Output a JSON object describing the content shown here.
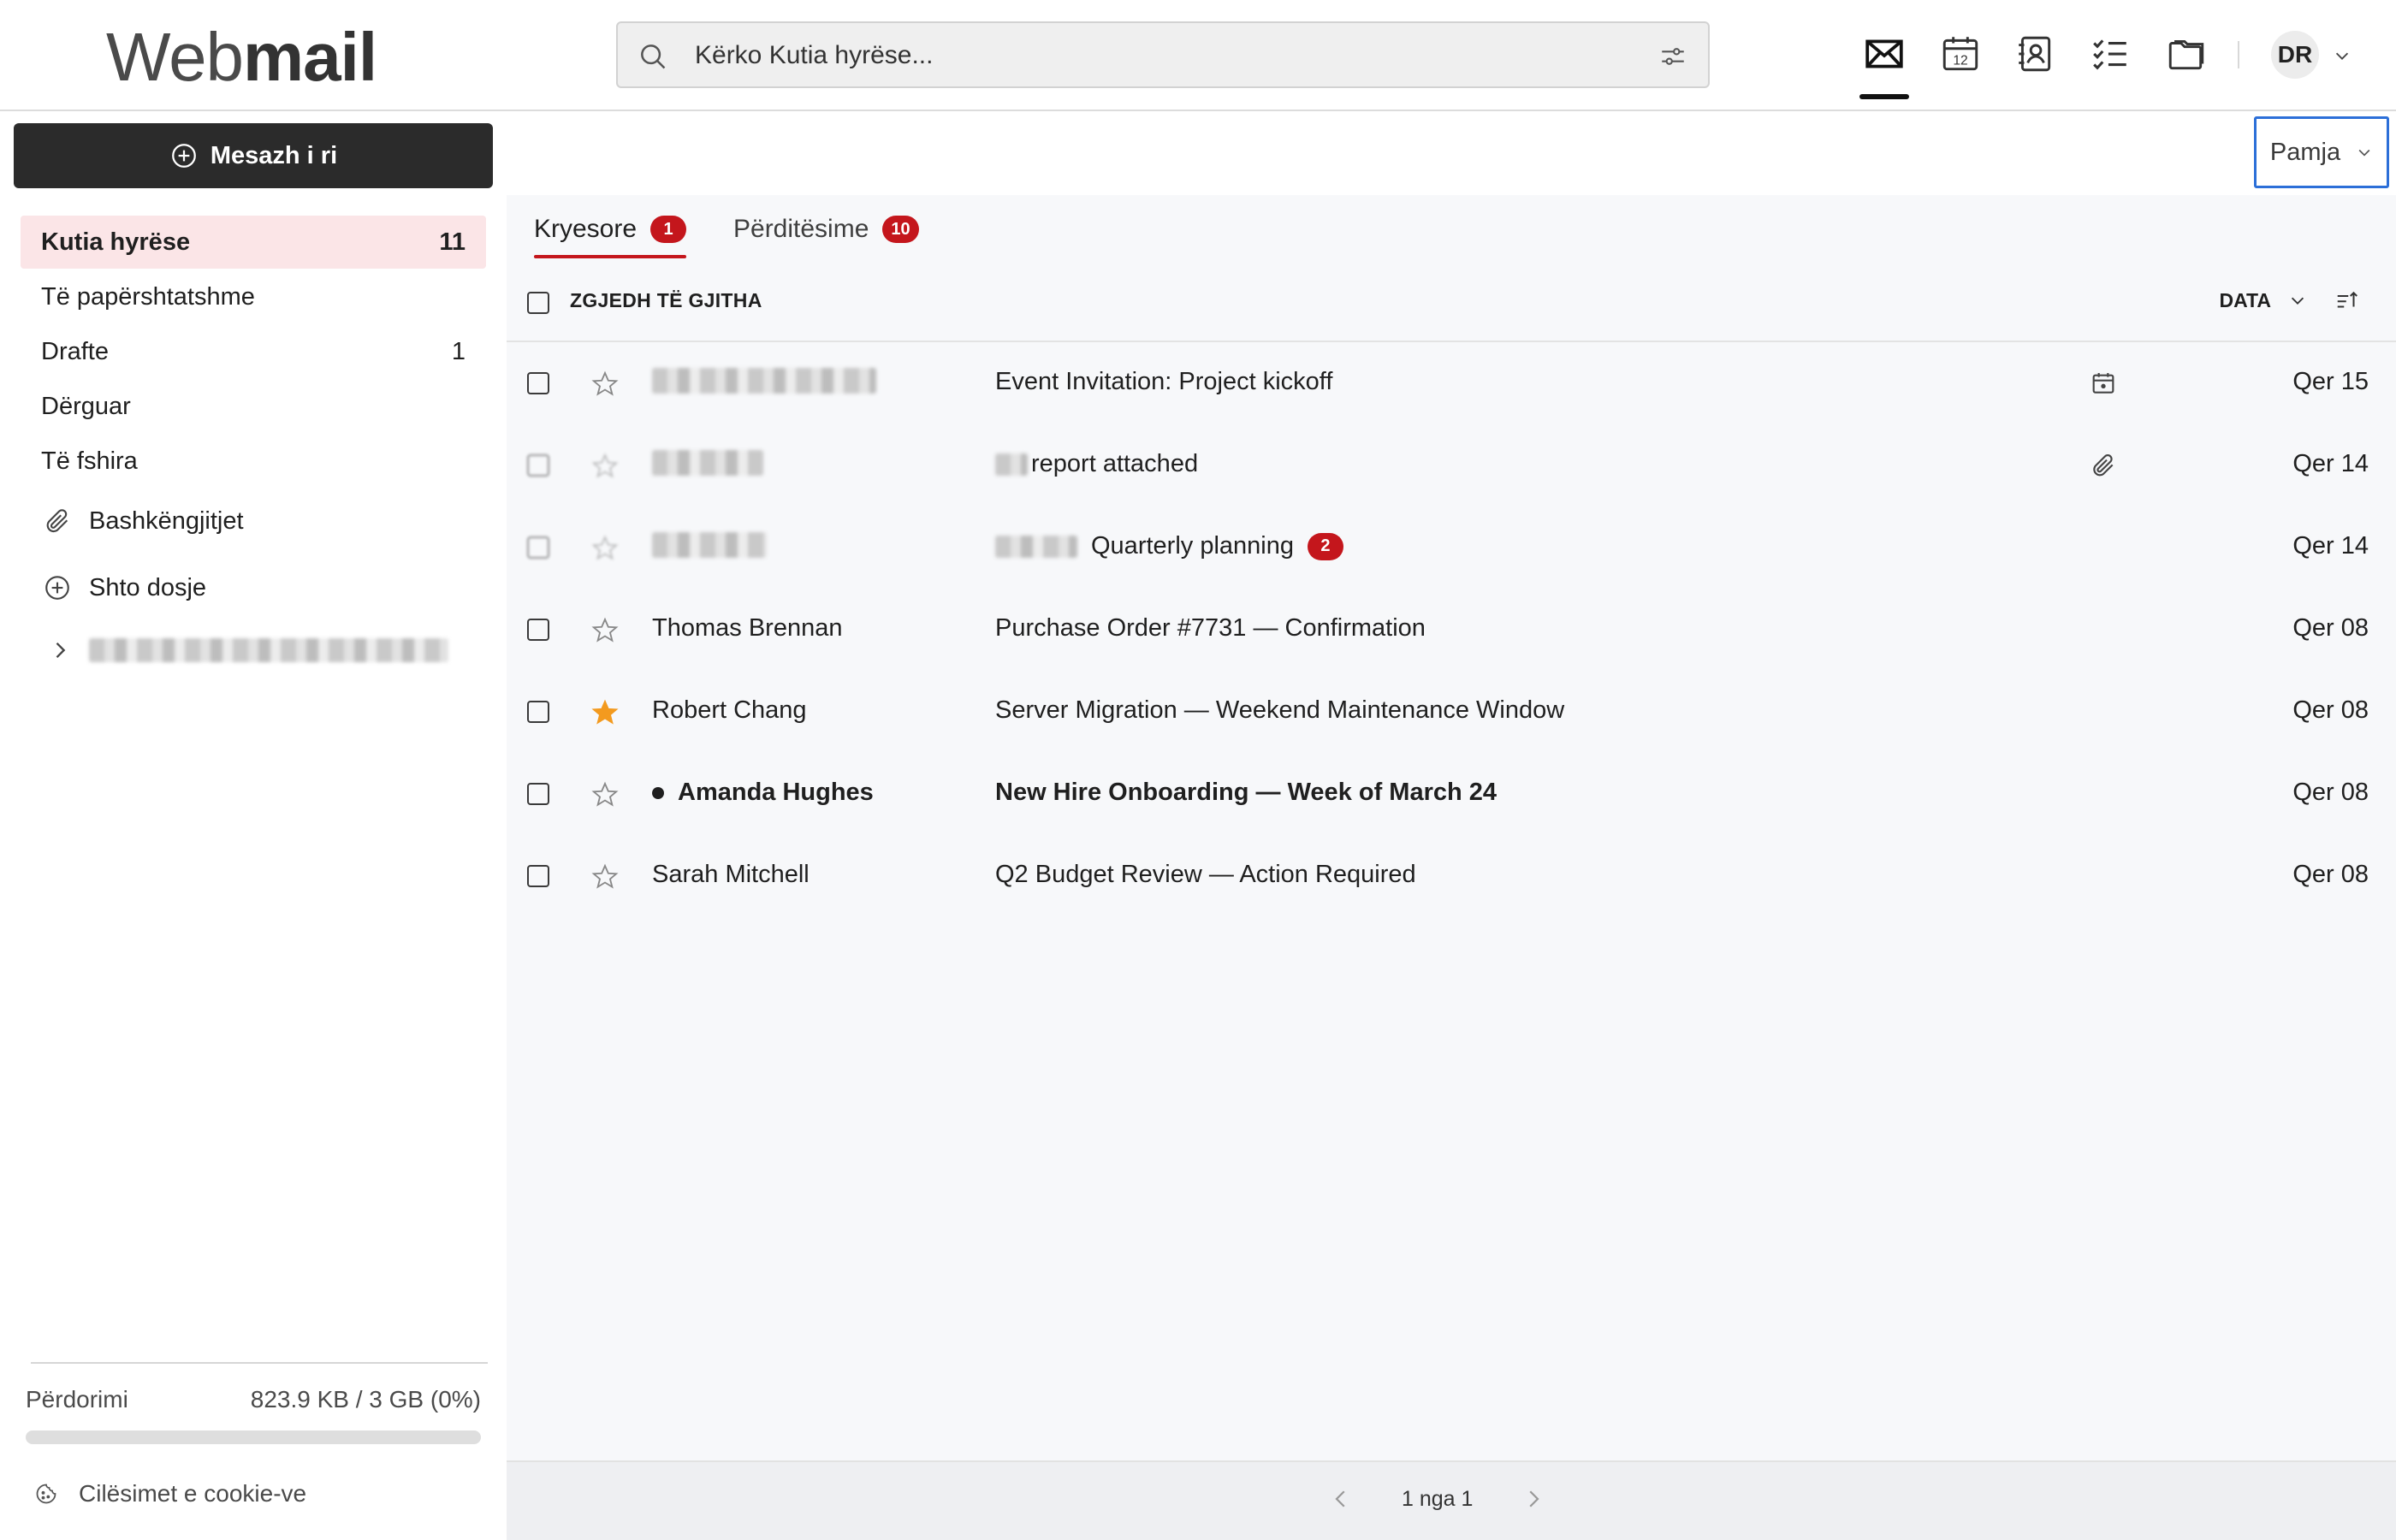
{
  "app": {
    "logo_light": "Web",
    "logo_bold": "mail"
  },
  "search": {
    "placeholder": "Kërko Kutia hyrëse..."
  },
  "header": {
    "nav_icons": [
      "mail-icon",
      "calendar-icon",
      "contacts-icon",
      "tasks-icon",
      "files-icon"
    ],
    "calendar_day": "12",
    "avatar_initials": "DR"
  },
  "sidebar": {
    "new_message_label": "Mesazh i ri",
    "folders": [
      {
        "label": "Kutia hyrëse",
        "count": "11",
        "active": true
      },
      {
        "label": "Të papërshtatshme",
        "count": ""
      },
      {
        "label": "Drafte",
        "count": "1"
      },
      {
        "label": "Dërguar",
        "count": ""
      },
      {
        "label": "Të fshira",
        "count": ""
      }
    ],
    "attachments_label": "Bashkëngjitjet",
    "add_folder_label": "Shto dosje",
    "usage_label": "Përdorimi",
    "usage_value": "823.9 KB / 3 GB (0%)",
    "usage_percent": 0,
    "cookie_label": "Cilësimet e cookie-ve"
  },
  "toolbar": {
    "view_label": "Pamja"
  },
  "tabs": [
    {
      "label": "Kryesore",
      "badge": "1",
      "active": true
    },
    {
      "label": "Përditësime",
      "badge": "10",
      "active": false
    }
  ],
  "list_header": {
    "select_all_label": "ZGJEDH TË GJITHA",
    "sort_label": "DATA"
  },
  "messages": [
    {
      "sender": "",
      "subject": "Event Invitation: Project kickoff",
      "date": "Qer 15",
      "starred": false,
      "unread": false,
      "icon": "calendar-icon",
      "badge": ""
    },
    {
      "sender": "",
      "subject": "report attached",
      "date": "Qer 14",
      "starred": false,
      "unread": false,
      "icon": "attachment-icon",
      "badge": ""
    },
    {
      "sender": "",
      "subject": "Quarterly planning",
      "date": "Qer 14",
      "starred": false,
      "unread": false,
      "icon": "",
      "badge": "2"
    },
    {
      "sender": "Thomas Brennan",
      "subject": "Purchase Order #7731 — Confirmation",
      "date": "Qer 08",
      "starred": false,
      "unread": false,
      "icon": "",
      "badge": ""
    },
    {
      "sender": "Robert Chang",
      "subject": "Server Migration — Weekend Maintenance Window",
      "date": "Qer 08",
      "starred": true,
      "unread": false,
      "icon": "",
      "badge": ""
    },
    {
      "sender": "Amanda Hughes",
      "subject": "New Hire Onboarding — Week of March 24",
      "date": "Qer 08",
      "starred": false,
      "unread": true,
      "icon": "",
      "badge": ""
    },
    {
      "sender": "Sarah Mitchell",
      "subject": "Q2 Budget Review — Action Required",
      "date": "Qer 08",
      "starred": false,
      "unread": false,
      "icon": "",
      "badge": ""
    }
  ],
  "pagination": {
    "label": "1 nga 1"
  },
  "colors": {
    "accent_red": "#c4161c",
    "active_folder_bg": "#fbe5e7",
    "focus_blue": "#2c6fd8",
    "star_orange": "#f39a1e"
  }
}
